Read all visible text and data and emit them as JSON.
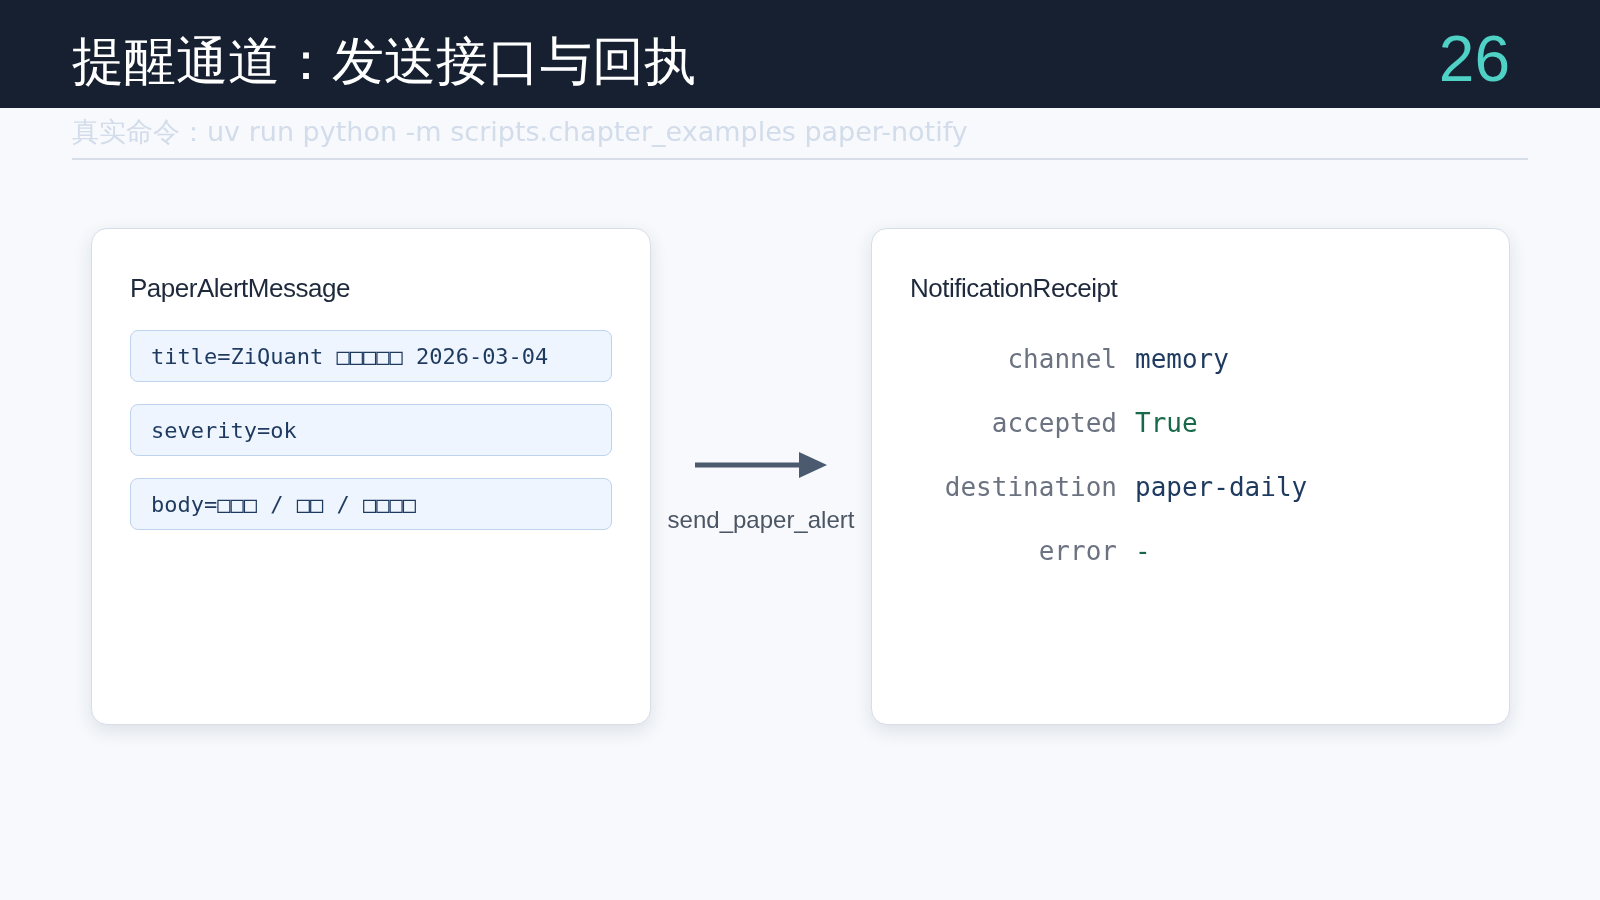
{
  "header": {
    "title": "提醒通道：发送接口与回执",
    "page_number": "26"
  },
  "subtitle": "真实命令：uv run python -m scripts.chapter_examples paper-notify",
  "message_card": {
    "title": "PaperAlertMessage",
    "fields": [
      {
        "text": "title=ZiQuant □□□□□ 2026-03-04"
      },
      {
        "text": "severity=ok"
      },
      {
        "text": "body=□□□ / □□ / □□□□"
      }
    ]
  },
  "call": {
    "label": "send_paper_alert"
  },
  "receipt_card": {
    "title": "NotificationReceipt",
    "fields": [
      {
        "key": "channel",
        "value": "memory",
        "color": "#1e3a5f"
      },
      {
        "key": "accepted",
        "value": "True",
        "color": "#17694a"
      },
      {
        "key": "destination",
        "value": "paper-daily",
        "color": "#1e3a5f"
      },
      {
        "key": "error",
        "value": "-",
        "color": "#17694a"
      }
    ]
  }
}
